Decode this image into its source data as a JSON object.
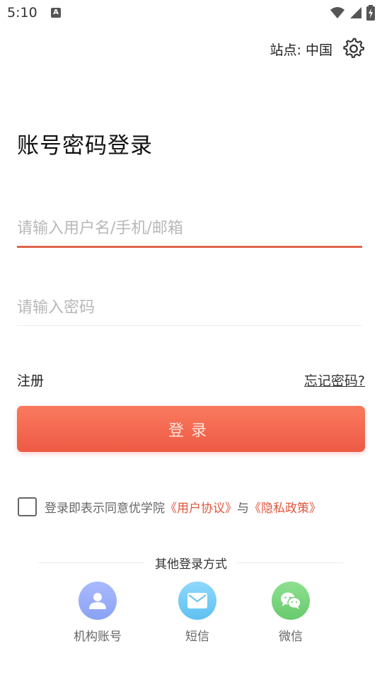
{
  "status_bar": {
    "time": "5:10",
    "notification_icon": "A"
  },
  "header": {
    "site_label": "站点: 中国"
  },
  "page_title": "账号密码登录",
  "form": {
    "username_placeholder": "请输入用户名/手机/邮箱",
    "username_value": "",
    "password_placeholder": "请输入密码",
    "password_value": ""
  },
  "links": {
    "register": "注册",
    "forgot_password": "忘记密码?"
  },
  "login_button": "登录",
  "agreement": {
    "prefix": "登录即表示同意优学院",
    "user_agreement": "《用户协议》",
    "connector": "与",
    "privacy_policy": "《隐私政策》",
    "checked": false
  },
  "other_login": {
    "title": "其他登录方式",
    "methods": [
      {
        "label": "机构账号",
        "icon": "person-icon"
      },
      {
        "label": "短信",
        "icon": "envelope-icon"
      },
      {
        "label": "微信",
        "icon": "wechat-icon"
      }
    ]
  },
  "colors": {
    "accent": "#ee5a45",
    "link": "#e0563f"
  }
}
